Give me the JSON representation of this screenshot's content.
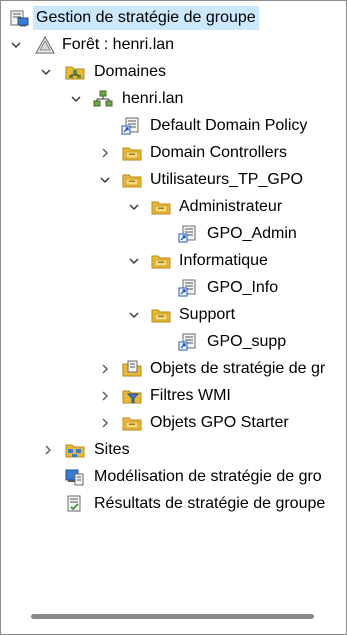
{
  "tree": {
    "root": "Gestion de stratégie de groupe",
    "forest": "Forêt : henri.lan",
    "domains": "Domaines",
    "domain": "henri.lan",
    "default_policy": "Default Domain Policy",
    "domain_controllers": "Domain Controllers",
    "ou_users": "Utilisateurs_TP_GPO",
    "ou_admin": "Administrateur",
    "gpo_admin": "GPO_Admin",
    "ou_info": "Informatique",
    "gpo_info": "GPO_Info",
    "ou_support": "Support",
    "gpo_supp": "GPO_supp",
    "gpo_objects": "Objets de stratégie de gr",
    "wmi_filters": "Filtres WMI",
    "starter_gpos": "Objets GPO Starter",
    "sites": "Sites",
    "modeling": "Modélisation de stratégie de gro",
    "results": "Résultats de stratégie de groupe"
  },
  "icons": {
    "root": "gpmc-console-icon",
    "forest": "forest-icon",
    "domain": "domain-icon",
    "gpo": "gpo-link-icon",
    "ou": "folder-icon"
  },
  "colors": {
    "selection": "#cce8ff",
    "folder": "#e8b93a",
    "scroll_thumb": "#8a8a8a"
  }
}
